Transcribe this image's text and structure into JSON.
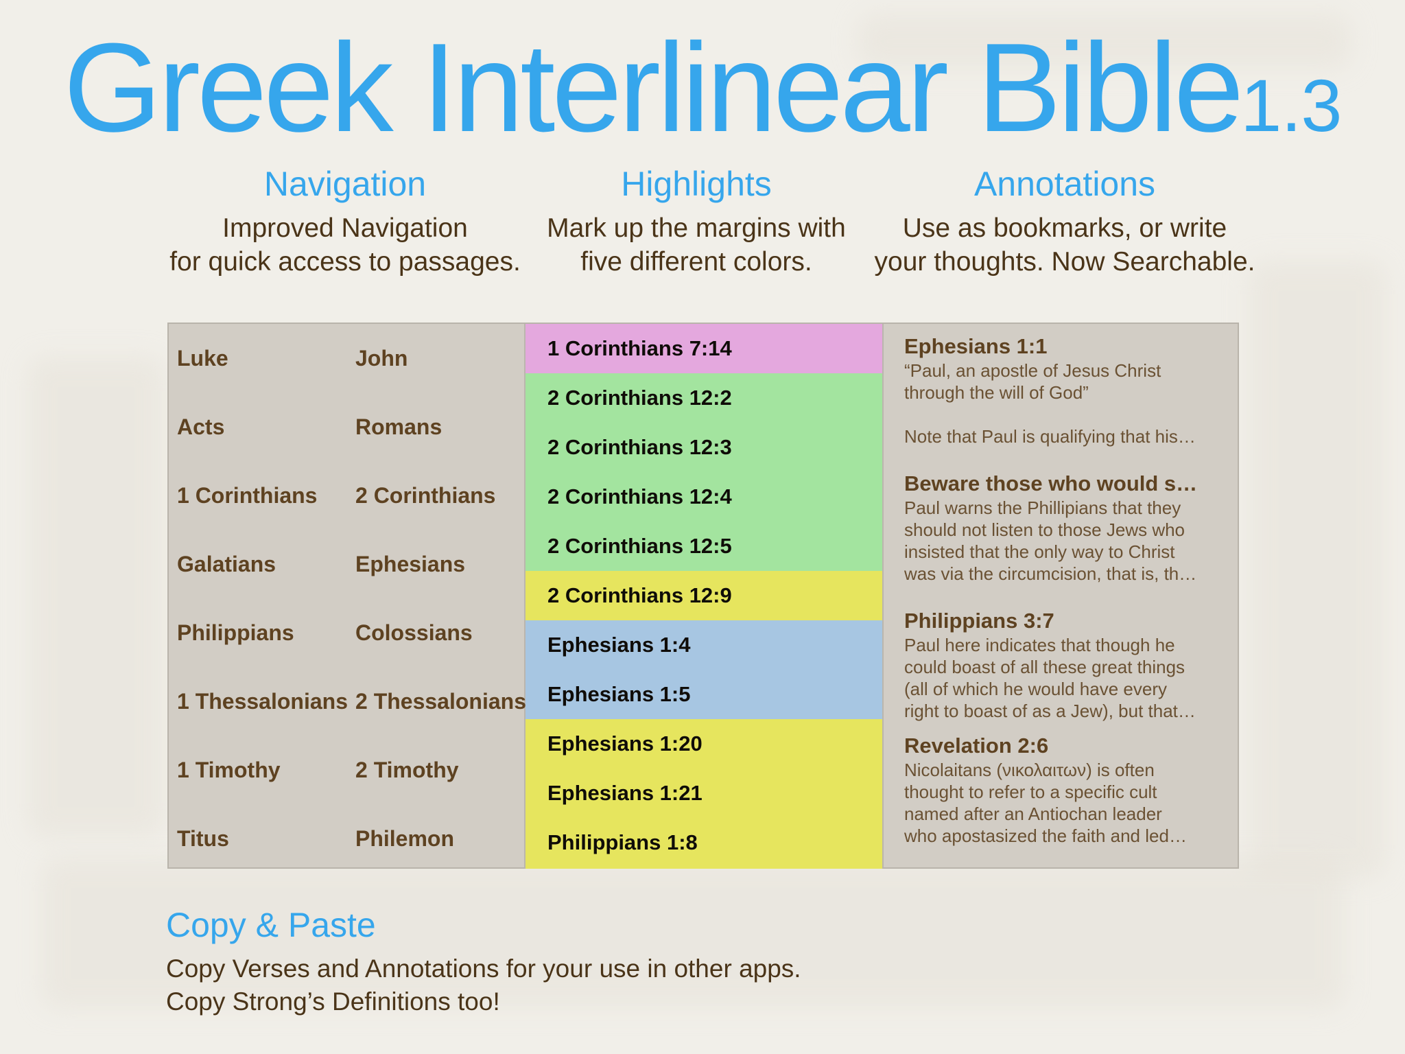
{
  "title": {
    "main": "Greek Interlinear Bible",
    "version": "1.3"
  },
  "features": [
    {
      "heading": "Navigation",
      "lines": [
        "Improved Navigation",
        "for quick access to passages."
      ]
    },
    {
      "heading": "Highlights",
      "lines": [
        "Mark up the margins with",
        "five different colors."
      ]
    },
    {
      "heading": "Annotations",
      "lines": [
        "Use as bookmarks, or write",
        "your thoughts. Now Searchable."
      ]
    }
  ],
  "navigation": {
    "books": [
      [
        "Luke",
        "John"
      ],
      [
        "Acts",
        "Romans"
      ],
      [
        "1 Corinthians",
        "2 Corinthians"
      ],
      [
        "Galatians",
        "Ephesians"
      ],
      [
        "Philippians",
        "Colossians"
      ],
      [
        "1 Thessalonians",
        "2 Thessalonians"
      ],
      [
        "1 Timothy",
        "2 Timothy"
      ],
      [
        "Titus",
        "Philemon"
      ]
    ]
  },
  "highlights": [
    {
      "ref": "1 Corinthians 7:14",
      "color": "#e4a8de"
    },
    {
      "ref": "2 Corinthians 12:2",
      "color": "#a3e49f"
    },
    {
      "ref": "2 Corinthians 12:3",
      "color": "#a3e49f"
    },
    {
      "ref": "2 Corinthians 12:4",
      "color": "#a3e49f"
    },
    {
      "ref": "2 Corinthians 12:5",
      "color": "#a3e49f"
    },
    {
      "ref": "2 Corinthians 12:9",
      "color": "#e6e55e"
    },
    {
      "ref": "Ephesians 1:4",
      "color": "#a7c6e2"
    },
    {
      "ref": "Ephesians 1:5",
      "color": "#a7c6e2"
    },
    {
      "ref": "Ephesians 1:20",
      "color": "#e6e55e"
    },
    {
      "ref": "Ephesians 1:21",
      "color": "#e6e55e"
    },
    {
      "ref": "Philippians 1:8",
      "color": "#e6e55e"
    }
  ],
  "annotations": [
    {
      "title": "Ephesians 1:1",
      "lines": [
        "“Paul, an apostle of Jesus Christ",
        "through the will of God”",
        "",
        "Note that Paul is qualifying that his…"
      ]
    },
    {
      "title": "Beware those who would s…",
      "lines": [
        "Paul warns the Phillipians that they",
        "should not listen to those Jews who",
        "insisted that the only way to Christ",
        "was via the circumcision, that is, th…"
      ]
    },
    {
      "title": "Philippians 3:7",
      "lines": [
        "Paul here indicates that though he",
        "could boast of all these great things",
        "(all of which he would have every",
        "right to boast of as a Jew), but that…"
      ]
    },
    {
      "title": "Revelation 2:6",
      "lines": [
        "Nicolaitans (νικολαιτων) is often",
        "thought to refer to a specific cult",
        "named after an Antiochan leader",
        "who apostasized the faith and led…"
      ]
    }
  ],
  "copy_paste": {
    "heading": "Copy & Paste",
    "lines": [
      "Copy Verses and Annotations for your use in other apps.",
      "Copy Strong’s Definitions too!"
    ]
  }
}
